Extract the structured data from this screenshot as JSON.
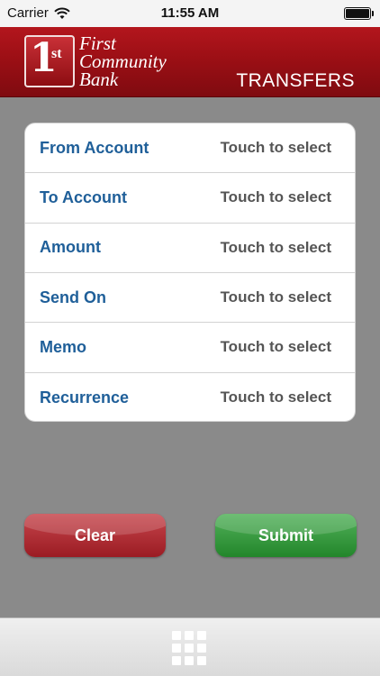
{
  "status_bar": {
    "carrier": "Carrier",
    "time": "11:55 AM"
  },
  "header": {
    "logo": {
      "number": "1",
      "suffix": "st",
      "bank_name_line1": "First",
      "bank_name_line2": "Community",
      "bank_name_line3": "Bank"
    },
    "title": "TRANSFERS"
  },
  "form": {
    "rows": [
      {
        "label": "From Account",
        "value": "Touch to select"
      },
      {
        "label": "To Account",
        "value": "Touch to select"
      },
      {
        "label": "Amount",
        "value": "Touch to select"
      },
      {
        "label": "Send On",
        "value": "Touch to select"
      },
      {
        "label": "Memo",
        "value": "Touch to select"
      },
      {
        "label": "Recurrence",
        "value": "Touch to select"
      }
    ]
  },
  "buttons": {
    "clear_label": "Clear",
    "submit_label": "Submit"
  },
  "bottom_bar": {
    "icon": "grid-menu-icon"
  },
  "colors": {
    "header_red": "#9c0f15",
    "label_blue": "#1f5f99",
    "clear_red": "#b02a31",
    "submit_green": "#2f9537",
    "background_gray": "#8a8a8a"
  }
}
